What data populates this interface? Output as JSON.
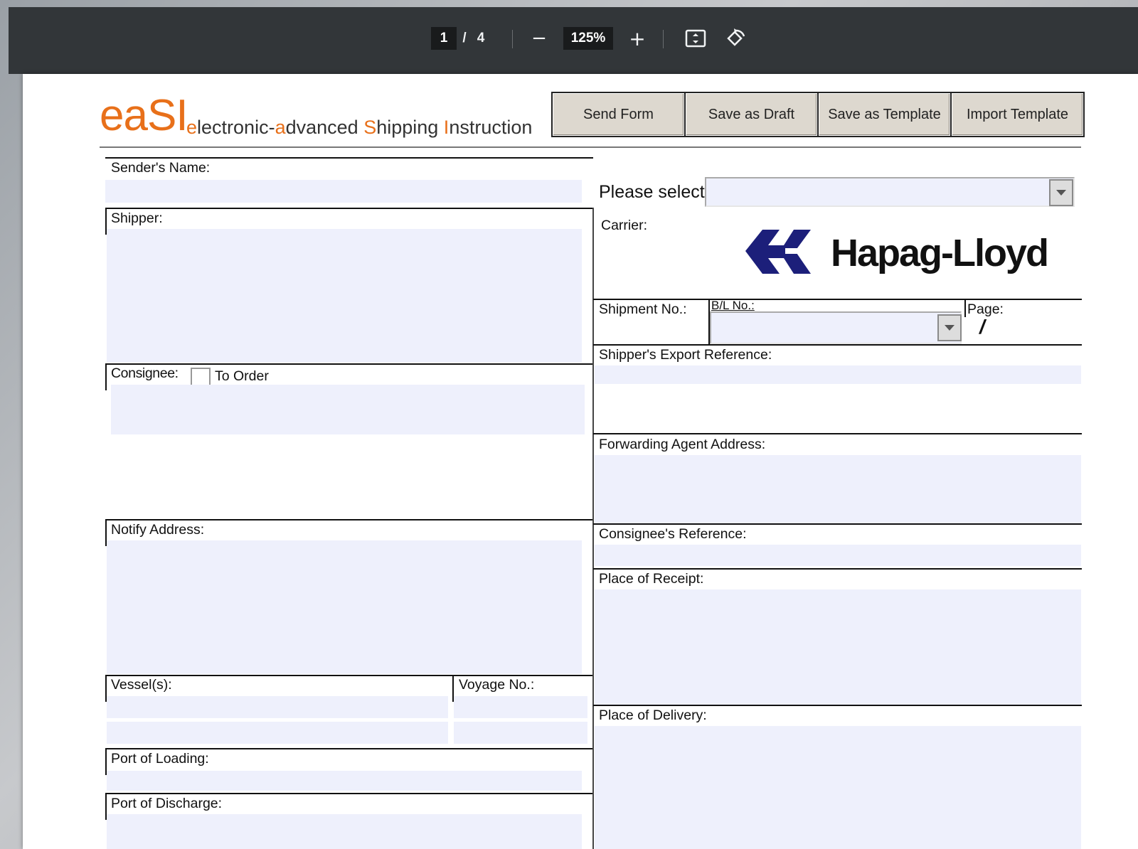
{
  "viewer": {
    "page_current": "1",
    "page_separator": "/",
    "page_total": "4",
    "zoom": "125%",
    "zoom_out": "−",
    "zoom_in": "+"
  },
  "form": {
    "logo_main": "eaSI",
    "logo_sub": {
      "e": "e",
      "lectronic": "lectronic-",
      "a": "a",
      "dvanced": "dvanced ",
      "S": "S",
      "hipping": "hipping ",
      "I": "I",
      "nstruction": "nstruction"
    },
    "buttons": {
      "send": "Send Form",
      "draft": "Save as Draft",
      "template": "Save as Template",
      "import": "Import Template"
    },
    "left": {
      "senders_name": "Sender's Name:",
      "shipper": "Shipper:",
      "consignee": "Consignee:",
      "to_order": "To Order",
      "notify": "Notify Address:",
      "vessels": "Vessel(s):",
      "voyage": "Voyage No.:",
      "port_loading": "Port of Loading:",
      "port_discharge": "Port of Discharge:"
    },
    "right": {
      "please_select": "Please select:",
      "carrier": "Carrier:",
      "carrier_logo": "Hapag-Lloyd",
      "shipment_no": "Shipment No.:",
      "bl_no": "B/L No.:",
      "page": "Page:",
      "page_value": "/",
      "export_ref": "Shipper's Export Reference:",
      "forwarding": "Forwarding Agent Address:",
      "consignee_ref": "Consignee's Reference:",
      "place_receipt": "Place of Receipt:",
      "place_delivery": "Place of Delivery:"
    }
  }
}
